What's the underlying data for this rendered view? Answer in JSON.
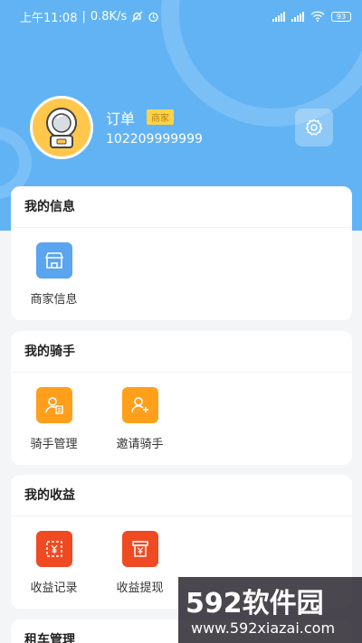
{
  "status_bar": {
    "time": "上午11:08",
    "speed": "0.8K/s",
    "battery": "93"
  },
  "profile": {
    "name": "订单",
    "role_badge": "商家",
    "phone": "102209999999"
  },
  "sections": [
    {
      "title": "我的信息",
      "items": [
        {
          "label": "商家信息",
          "icon": "store-icon",
          "color": "#5aa4f0"
        }
      ]
    },
    {
      "title": "我的骑手",
      "items": [
        {
          "label": "骑手管理",
          "icon": "rider-manage-icon",
          "color": "#ff9f1c"
        },
        {
          "label": "邀请骑手",
          "icon": "invite-rider-icon",
          "color": "#ff9f1c"
        }
      ]
    },
    {
      "title": "我的收益",
      "items": [
        {
          "label": "收益记录",
          "icon": "earnings-record-icon",
          "color": "#f04a22"
        },
        {
          "label": "收益提现",
          "icon": "withdraw-icon",
          "color": "#f04a22"
        }
      ]
    },
    {
      "title": "租车管理",
      "items": []
    }
  ],
  "colors": {
    "header": "#61b3f4",
    "badge": "#ffd24a",
    "page_bg": "#f4f5f7"
  },
  "watermark": {
    "brand": "592软件园",
    "url": "www.592xiazai.com"
  }
}
